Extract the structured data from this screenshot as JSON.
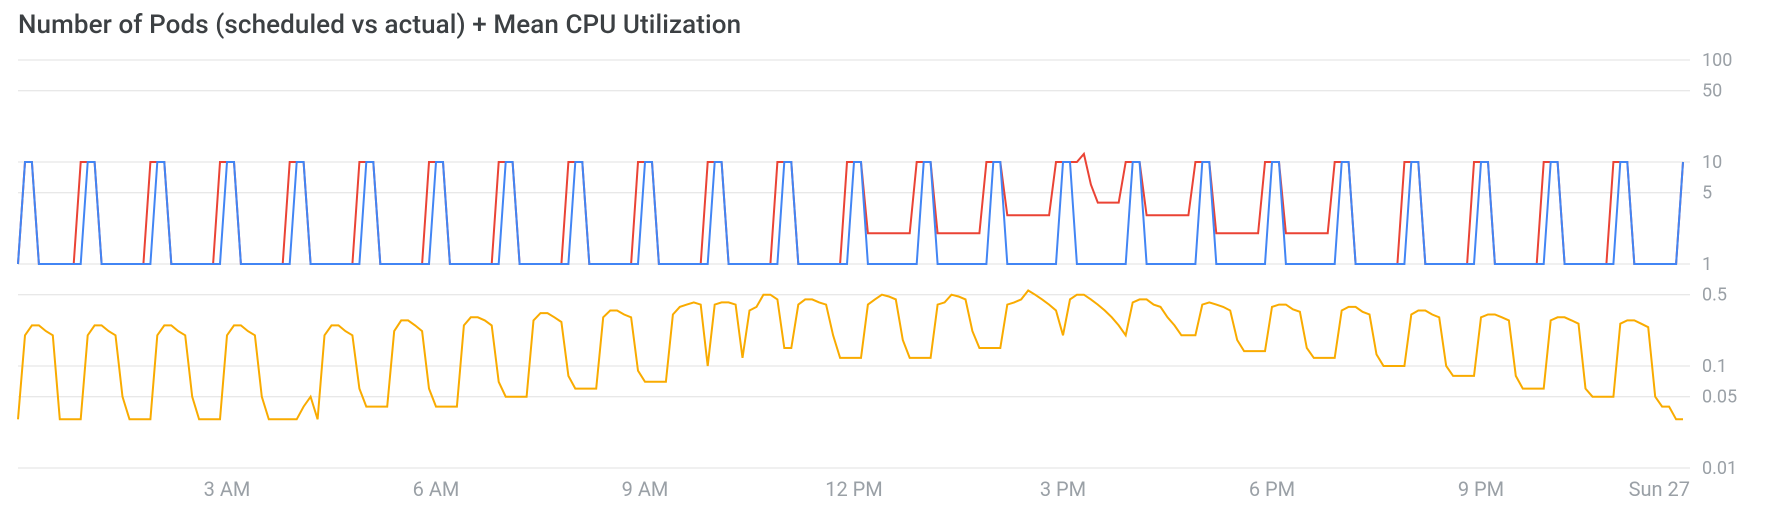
{
  "chart_data": {
    "type": "line",
    "title": "Number of Pods (scheduled vs actual) + Mean CPU Utilization",
    "yscale": "log",
    "ylim": [
      0.01,
      100
    ],
    "yticks": [
      100,
      50,
      10,
      5,
      1,
      0.5,
      0.1,
      0.05,
      0.01
    ],
    "xticks": [
      "3 AM",
      "6 AM",
      "9 AM",
      "12 PM",
      "3 PM",
      "6 PM",
      "9 PM",
      "Sun 27"
    ],
    "xtick_hours": [
      3,
      6,
      9,
      12,
      15,
      18,
      21,
      24
    ],
    "x_range_hours": [
      0,
      24
    ],
    "colors": {
      "scheduled": "#ea4335",
      "actual": "#4285f4",
      "cpu": "#f9ab00"
    },
    "series": [
      {
        "name": "Pods scheduled",
        "color": "#ea4335",
        "x_step_hours": 0.1,
        "values": [
          1,
          10,
          10,
          1,
          1,
          1,
          1,
          1,
          1,
          10,
          10,
          10,
          1,
          1,
          1,
          1,
          1,
          1,
          1,
          10,
          10,
          10,
          1,
          1,
          1,
          1,
          1,
          1,
          1,
          10,
          10,
          10,
          1,
          1,
          1,
          1,
          1,
          1,
          1,
          10,
          10,
          10,
          1,
          1,
          1,
          1,
          1,
          1,
          1,
          10,
          10,
          10,
          1,
          1,
          1,
          1,
          1,
          1,
          1,
          10,
          10,
          10,
          1,
          1,
          1,
          1,
          1,
          1,
          1,
          10,
          10,
          10,
          1,
          1,
          1,
          1,
          1,
          1,
          1,
          10,
          10,
          10,
          1,
          1,
          1,
          1,
          1,
          1,
          1,
          10,
          10,
          10,
          1,
          1,
          1,
          1,
          1,
          1,
          1,
          10,
          10,
          10,
          1,
          1,
          1,
          1,
          1,
          1,
          1,
          10,
          10,
          10,
          1,
          1,
          1,
          1,
          1,
          1,
          1,
          10,
          10,
          10,
          2,
          2,
          2,
          2,
          2,
          2,
          2,
          10,
          10,
          10,
          2,
          2,
          2,
          2,
          2,
          2,
          2,
          10,
          10,
          10,
          3,
          3,
          3,
          3,
          3,
          3,
          3,
          10,
          10,
          10,
          10,
          12,
          6,
          4,
          4,
          4,
          4,
          10,
          10,
          10,
          3,
          3,
          3,
          3,
          3,
          3,
          3,
          10,
          10,
          10,
          2,
          2,
          2,
          2,
          2,
          2,
          2,
          10,
          10,
          10,
          2,
          2,
          2,
          2,
          2,
          2,
          2,
          10,
          10,
          10,
          1,
          1,
          1,
          1,
          1,
          1,
          1,
          10,
          10,
          10,
          1,
          1,
          1,
          1,
          1,
          1,
          1,
          10,
          10,
          10,
          1,
          1,
          1,
          1,
          1,
          1,
          1,
          10,
          10,
          10,
          1,
          1,
          1,
          1,
          1,
          1,
          1,
          10,
          10,
          10,
          1,
          1,
          1,
          1,
          1,
          1,
          1,
          10
        ]
      },
      {
        "name": "Pods actual",
        "color": "#4285f4",
        "x_step_hours": 0.1,
        "values": [
          1,
          10,
          10,
          1,
          1,
          1,
          1,
          1,
          1,
          1,
          10,
          10,
          1,
          1,
          1,
          1,
          1,
          1,
          1,
          1,
          10,
          10,
          1,
          1,
          1,
          1,
          1,
          1,
          1,
          1,
          10,
          10,
          1,
          1,
          1,
          1,
          1,
          1,
          1,
          1,
          10,
          10,
          1,
          1,
          1,
          1,
          1,
          1,
          1,
          1,
          10,
          10,
          1,
          1,
          1,
          1,
          1,
          1,
          1,
          1,
          10,
          10,
          1,
          1,
          1,
          1,
          1,
          1,
          1,
          1,
          10,
          10,
          1,
          1,
          1,
          1,
          1,
          1,
          1,
          1,
          10,
          10,
          1,
          1,
          1,
          1,
          1,
          1,
          1,
          1,
          10,
          10,
          1,
          1,
          1,
          1,
          1,
          1,
          1,
          1,
          10,
          10,
          1,
          1,
          1,
          1,
          1,
          1,
          1,
          1,
          10,
          10,
          1,
          1,
          1,
          1,
          1,
          1,
          1,
          1,
          10,
          10,
          1,
          1,
          1,
          1,
          1,
          1,
          1,
          1,
          10,
          10,
          1,
          1,
          1,
          1,
          1,
          1,
          1,
          1,
          10,
          10,
          1,
          1,
          1,
          1,
          1,
          1,
          1,
          1,
          10,
          10,
          1,
          1,
          1,
          1,
          1,
          1,
          1,
          1,
          10,
          10,
          1,
          1,
          1,
          1,
          1,
          1,
          1,
          1,
          10,
          10,
          1,
          1,
          1,
          1,
          1,
          1,
          1,
          1,
          10,
          10,
          1,
          1,
          1,
          1,
          1,
          1,
          1,
          1,
          10,
          10,
          1,
          1,
          1,
          1,
          1,
          1,
          1,
          1,
          10,
          10,
          1,
          1,
          1,
          1,
          1,
          1,
          1,
          1,
          10,
          10,
          1,
          1,
          1,
          1,
          1,
          1,
          1,
          1,
          10,
          10,
          1,
          1,
          1,
          1,
          1,
          1,
          1,
          1,
          10,
          10,
          1,
          1,
          1,
          1,
          1,
          1,
          1,
          10
        ]
      },
      {
        "name": "Mean CPU utilization",
        "color": "#f9ab00",
        "x_step_hours": 0.1,
        "values": [
          0.03,
          0.2,
          0.25,
          0.25,
          0.22,
          0.2,
          0.03,
          0.03,
          0.03,
          0.03,
          0.2,
          0.25,
          0.25,
          0.22,
          0.2,
          0.05,
          0.03,
          0.03,
          0.03,
          0.03,
          0.2,
          0.25,
          0.25,
          0.22,
          0.2,
          0.05,
          0.03,
          0.03,
          0.03,
          0.03,
          0.2,
          0.25,
          0.25,
          0.22,
          0.2,
          0.05,
          0.03,
          0.03,
          0.03,
          0.03,
          0.03,
          0.04,
          0.05,
          0.03,
          0.2,
          0.25,
          0.25,
          0.22,
          0.2,
          0.06,
          0.04,
          0.04,
          0.04,
          0.04,
          0.22,
          0.28,
          0.28,
          0.25,
          0.22,
          0.06,
          0.04,
          0.04,
          0.04,
          0.04,
          0.25,
          0.3,
          0.3,
          0.28,
          0.25,
          0.07,
          0.05,
          0.05,
          0.05,
          0.05,
          0.28,
          0.33,
          0.33,
          0.3,
          0.27,
          0.08,
          0.06,
          0.06,
          0.06,
          0.06,
          0.3,
          0.35,
          0.35,
          0.32,
          0.3,
          0.09,
          0.07,
          0.07,
          0.07,
          0.07,
          0.32,
          0.38,
          0.4,
          0.42,
          0.4,
          0.1,
          0.4,
          0.42,
          0.42,
          0.4,
          0.12,
          0.35,
          0.38,
          0.5,
          0.5,
          0.45,
          0.15,
          0.15,
          0.4,
          0.45,
          0.45,
          0.42,
          0.4,
          0.2,
          0.12,
          0.12,
          0.12,
          0.12,
          0.4,
          0.45,
          0.5,
          0.48,
          0.45,
          0.18,
          0.12,
          0.12,
          0.12,
          0.12,
          0.4,
          0.42,
          0.5,
          0.48,
          0.45,
          0.22,
          0.15,
          0.15,
          0.15,
          0.15,
          0.4,
          0.42,
          0.45,
          0.55,
          0.5,
          0.45,
          0.4,
          0.35,
          0.2,
          0.45,
          0.5,
          0.5,
          0.45,
          0.4,
          0.35,
          0.3,
          0.25,
          0.2,
          0.42,
          0.45,
          0.45,
          0.4,
          0.38,
          0.3,
          0.25,
          0.2,
          0.2,
          0.2,
          0.4,
          0.42,
          0.4,
          0.38,
          0.35,
          0.18,
          0.14,
          0.14,
          0.14,
          0.14,
          0.38,
          0.4,
          0.4,
          0.36,
          0.34,
          0.15,
          0.12,
          0.12,
          0.12,
          0.12,
          0.35,
          0.38,
          0.38,
          0.34,
          0.32,
          0.13,
          0.1,
          0.1,
          0.1,
          0.1,
          0.32,
          0.35,
          0.35,
          0.32,
          0.3,
          0.1,
          0.08,
          0.08,
          0.08,
          0.08,
          0.3,
          0.32,
          0.32,
          0.3,
          0.28,
          0.08,
          0.06,
          0.06,
          0.06,
          0.06,
          0.28,
          0.3,
          0.3,
          0.28,
          0.26,
          0.06,
          0.05,
          0.05,
          0.05,
          0.05,
          0.26,
          0.28,
          0.28,
          0.26,
          0.24,
          0.05,
          0.04,
          0.04,
          0.03,
          0.03
        ]
      }
    ]
  }
}
